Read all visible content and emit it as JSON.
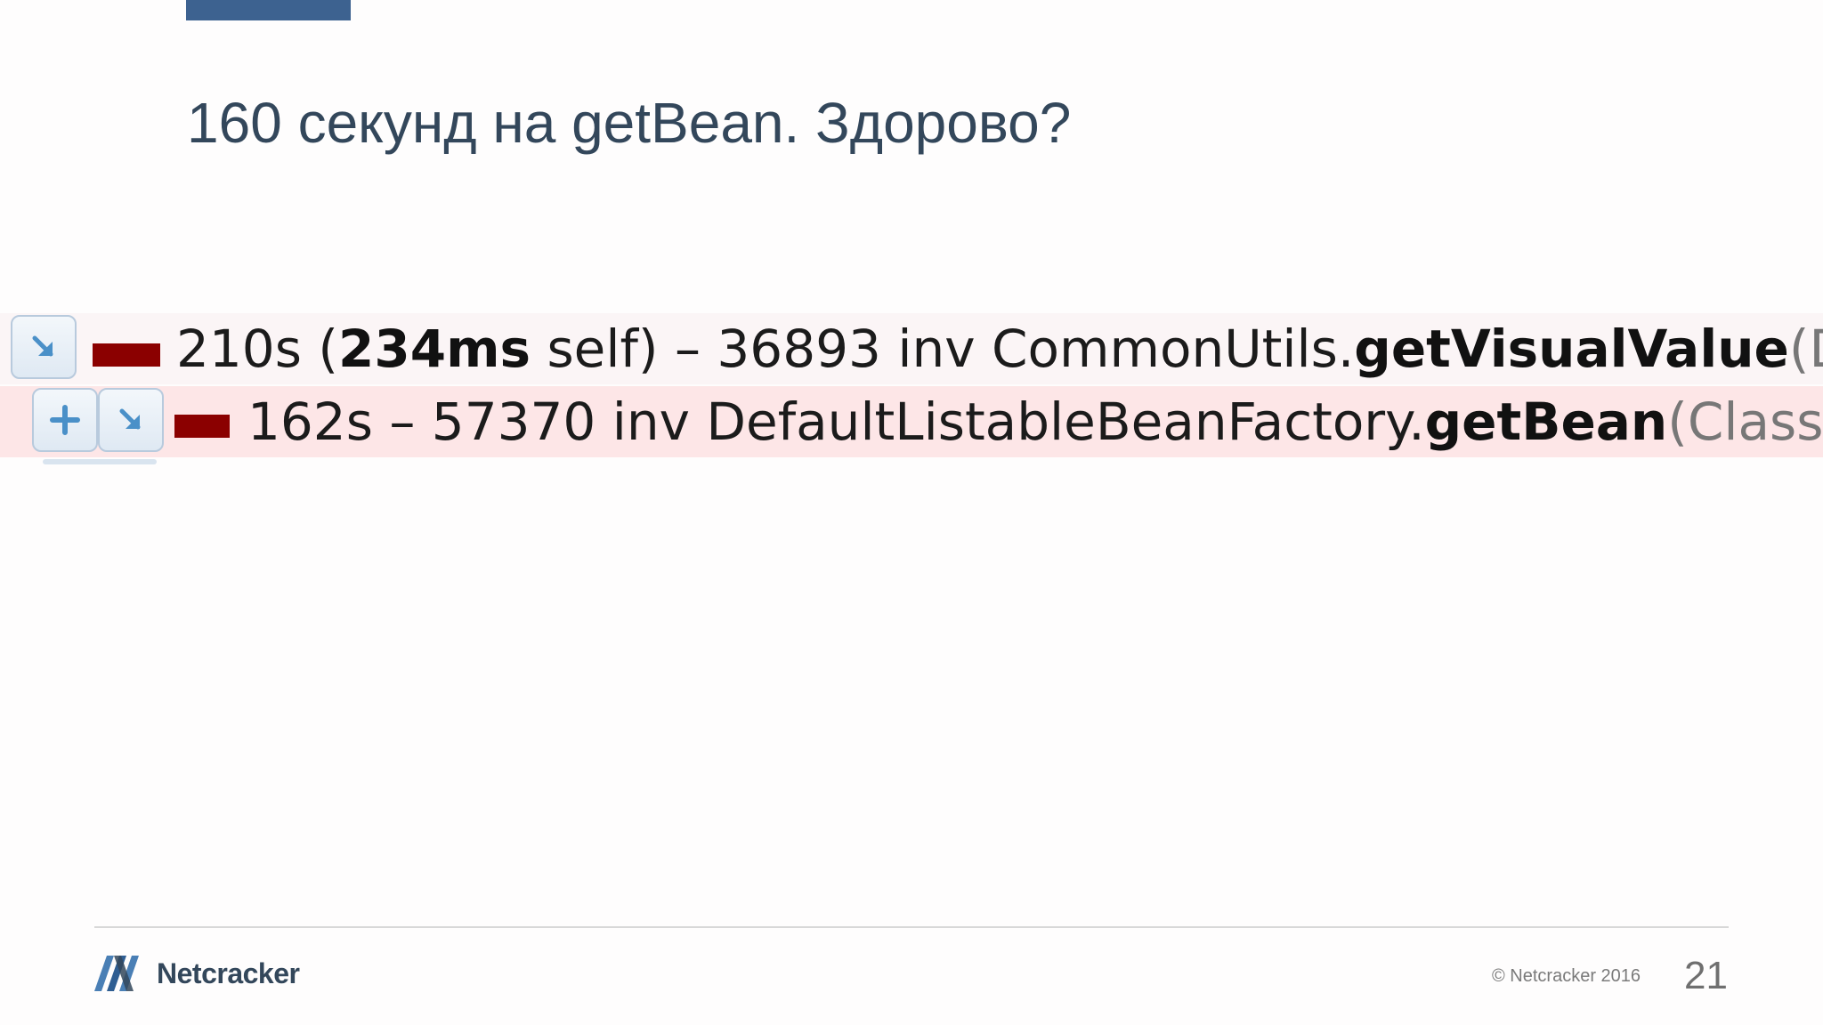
{
  "slide": {
    "title": "160 секунд на getBean. Здорово?",
    "accent_color": "#3d6290"
  },
  "profiler": {
    "rows": [
      {
        "time": "210s (",
        "self_time": "234ms",
        "self_suffix": " self) – 36893 inv CommonUtils.",
        "method": "getVisualValue",
        "params": "(D",
        "bar_color": "#8b0000",
        "icons": [
          "arrow-down-right-icon"
        ]
      },
      {
        "time": "162s – 57370 inv DefaultListableBeanFactory.",
        "method": "getBean",
        "params": "(Class)",
        "bar_color": "#8b0000",
        "icons": [
          "plus-icon",
          "arrow-down-right-icon"
        ]
      }
    ]
  },
  "footer": {
    "logo_text": "Netcracker",
    "copyright": "© Netcracker 2016",
    "page_number": "21"
  }
}
